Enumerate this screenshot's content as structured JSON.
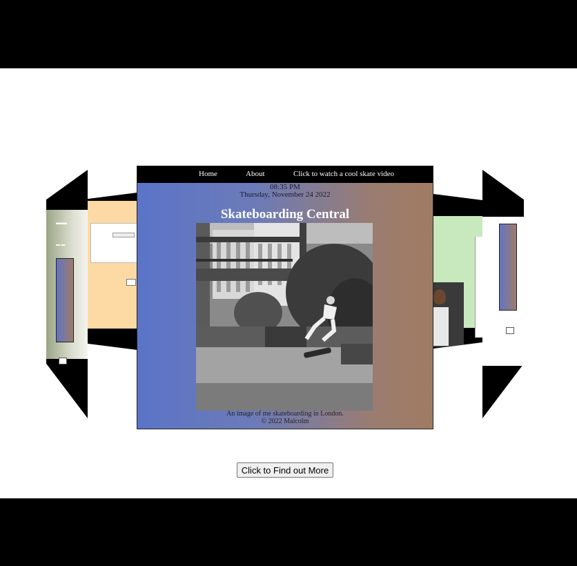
{
  "nav": {
    "home": "Home",
    "about": "About",
    "video": "Click to watch a cool skate video"
  },
  "header": {
    "time": "08:35 PM",
    "date": "Thursday, November 24 2022",
    "title": "Skateboarding Central"
  },
  "content": {
    "caption": "An image of me skateboarding in London.",
    "copyright": "© 2022 Malcolm"
  },
  "button": {
    "label": "Click to Find out More"
  },
  "colors": {
    "gradient_left": "#5b74c7",
    "gradient_right": "#a07b63",
    "left_panel_bg": "#fdd9a3",
    "right_panel_bg": "#c8e9bd"
  }
}
